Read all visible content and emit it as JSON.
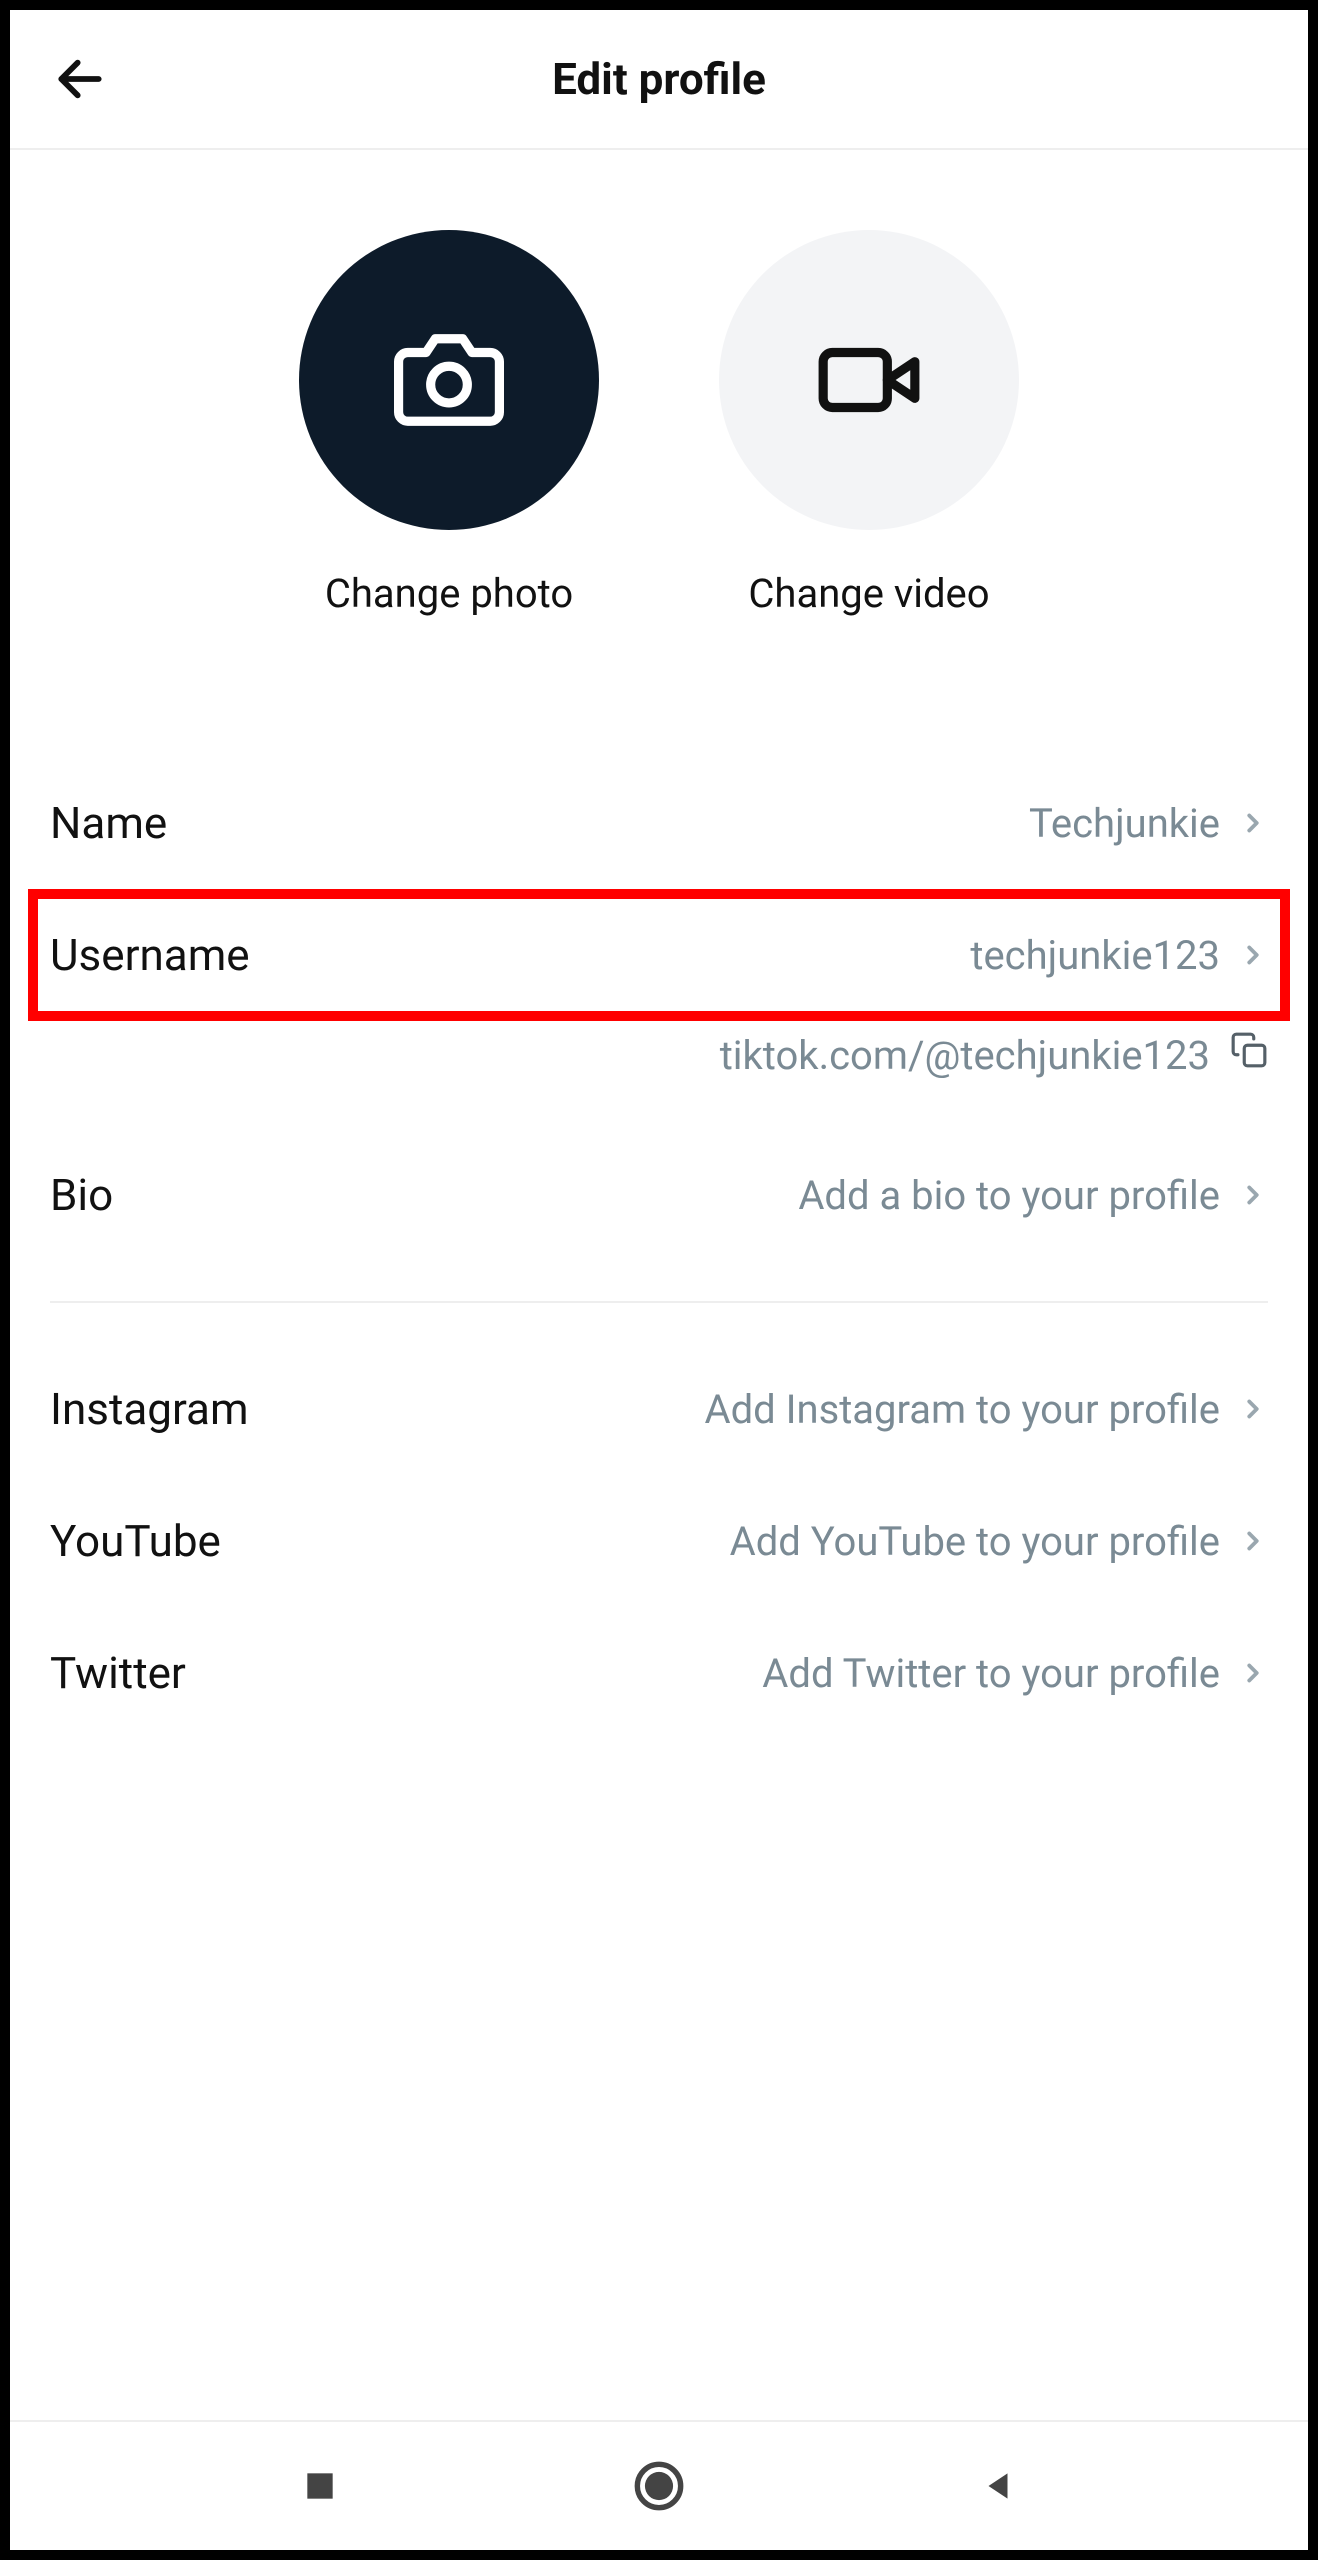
{
  "header": {
    "title": "Edit profile"
  },
  "media": {
    "photo_label": "Change photo",
    "video_label": "Change video"
  },
  "fields": {
    "name": {
      "label": "Name",
      "value": "Techjunkie"
    },
    "username": {
      "label": "Username",
      "value": "techjunkie123"
    },
    "profile_url": "tiktok.com/@techjunkie123",
    "bio": {
      "label": "Bio",
      "value": "Add a bio to your profile"
    }
  },
  "socials": {
    "instagram": {
      "label": "Instagram",
      "value": "Add Instagram to your profile"
    },
    "youtube": {
      "label": "YouTube",
      "value": "Add YouTube to your profile"
    },
    "twitter": {
      "label": "Twitter",
      "value": "Add Twitter to your profile"
    }
  }
}
